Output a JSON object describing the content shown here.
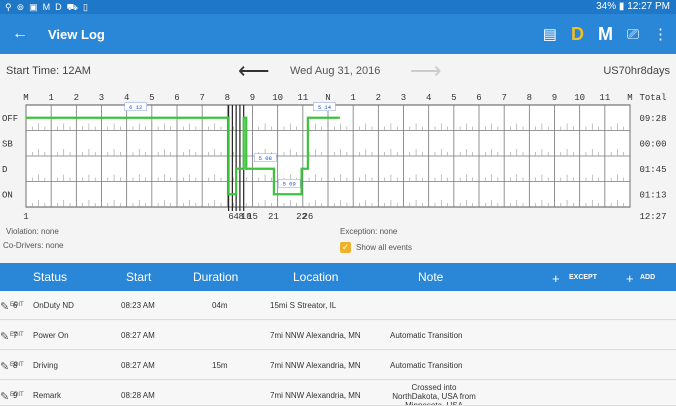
{
  "statusbar": {
    "left_icons": [
      "location-icon",
      "gps-icon",
      "image-icon",
      "M",
      "D",
      "drive-icon",
      "clipboard-icon"
    ],
    "left_glyphs": [
      "⚲",
      "⊚",
      "▣",
      "M",
      "D",
      "⛟",
      "▯"
    ],
    "battery": "34%",
    "time": "12:27 PM"
  },
  "appbar": {
    "title": "View Log",
    "back_glyph": "←",
    "d_label": "D",
    "m_label": "M",
    "chat_glyph": "▤",
    "device_glyph": "⎚",
    "more_glyph": "⋮"
  },
  "info": {
    "start_time": "Start Time: 12AM",
    "date": "Wed Aug 31, 2016",
    "cycle": "US70hr8days",
    "prev_glyph": "⟵",
    "next_glyph": "⟶"
  },
  "chart_data": {
    "type": "line",
    "hour_labels": [
      "M",
      "1",
      "2",
      "3",
      "4",
      "5",
      "6",
      "7",
      "8",
      "9",
      "10",
      "11",
      "N",
      "1",
      "2",
      "3",
      "4",
      "5",
      "6",
      "7",
      "8",
      "9",
      "10",
      "11",
      "M"
    ],
    "rows": [
      "OFF",
      "SB",
      "D",
      "ON"
    ],
    "total_label": "Total",
    "totals": [
      "09:28",
      "00:00",
      "01:45",
      "01:13"
    ],
    "grand_total": "12:27",
    "bottom_labels": [
      {
        "hour": 0,
        "text": "1"
      },
      {
        "hour": 8.15,
        "text": "6"
      },
      {
        "hour": 8.35,
        "text": "4"
      },
      {
        "hour": 8.55,
        "text": "8"
      },
      {
        "hour": 8.75,
        "text": "10"
      },
      {
        "hour": 9.0,
        "text": "15"
      },
      {
        "hour": 9.83,
        "text": "21"
      },
      {
        "hour": 10.95,
        "text": "22"
      },
      {
        "hour": 11.2,
        "text": "26"
      }
    ],
    "segments": [
      {
        "status": "OFF",
        "start": 0,
        "end": 8.05
      },
      {
        "status": "ON",
        "start": 8.05,
        "end": 8.35
      },
      {
        "status": "D",
        "start": 8.35,
        "end": 8.65
      },
      {
        "status": "OFF",
        "start": 8.65,
        "end": 8.75
      },
      {
        "status": "D",
        "start": 8.75,
        "end": 9.85
      },
      {
        "status": "ON",
        "start": 9.85,
        "end": 10.95
      },
      {
        "status": "D",
        "start": 10.95,
        "end": 11.2
      },
      {
        "status": "OFF",
        "start": 11.2,
        "end": 12.47
      }
    ],
    "markers": [
      {
        "hour": 4.0,
        "row": "OFF",
        "text": "6 12"
      },
      {
        "hour": 9.15,
        "row": "D",
        "text": "5 08"
      },
      {
        "hour": 10.1,
        "row": "ON",
        "text": "5 09"
      },
      {
        "hour": 11.5,
        "row": "OFF",
        "text": "5 14"
      }
    ],
    "line_color": "#3cc43c",
    "event_color": "#222222",
    "marker_color": "#1a4fd0"
  },
  "meta": {
    "violation": "Violation: none",
    "codrivers": "Co-Drivers: none",
    "exception": "Exception: none",
    "show_all": "Show all events",
    "check_glyph": "✓"
  },
  "table": {
    "headers": {
      "status": "Status",
      "start": "Start",
      "duration": "Duration",
      "location": "Location",
      "note": "Note",
      "except": "EXCEPT",
      "add": "ADD",
      "plus": "+"
    },
    "edit_label": "EDIT",
    "edit_glyph": "✎",
    "rows": [
      {
        "num": "6",
        "status": "OnDuty ND",
        "start": "08:23 AM",
        "duration": "04m",
        "location": "15mi S Streator, IL",
        "note": ""
      },
      {
        "num": "7",
        "status": "Power On",
        "start": "08:27 AM",
        "duration": "",
        "location": "7mi NNW Alexandria, MN",
        "note": "Automatic Transition"
      },
      {
        "num": "8",
        "status": "Driving",
        "start": "08:27 AM",
        "duration": "15m",
        "location": "7mi NNW Alexandria, MN",
        "note": "Automatic Transition"
      },
      {
        "num": "9",
        "status": "Remark",
        "start": "08:28 AM",
        "duration": "",
        "location": "7mi NNW Alexandria, MN",
        "note": "Crossed into NorthDakota, USA from Minnesota, USA"
      }
    ]
  }
}
